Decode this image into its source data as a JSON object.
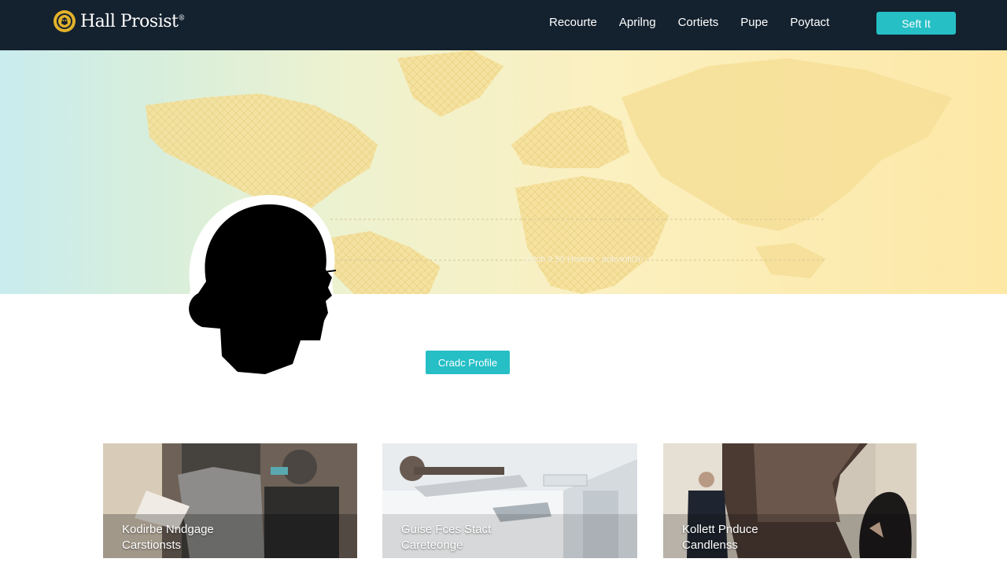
{
  "header": {
    "brand_name": "Hall Prosist",
    "brand_mark": "®",
    "nav": [
      {
        "label": "Recourte"
      },
      {
        "label": "Aprilng"
      },
      {
        "label": "Cortiets"
      },
      {
        "label": "Pupe"
      },
      {
        "label": "Poytact"
      }
    ],
    "cta_label": "Seft It"
  },
  "hero": {
    "caption": "isdob 0 50 Hoieox · aobviotiGn"
  },
  "profile": {
    "button_label": "Cradc Profile"
  },
  "cards": [
    {
      "line1": "Kodirbe Nndgage",
      "line2": "Carstionsts"
    },
    {
      "line1": "Guise Fces Stact",
      "line2": "Careteonge"
    },
    {
      "line1": "Kollett Pnduce",
      "line2": "Candlenss"
    }
  ],
  "colors": {
    "header_bg": "#14212e",
    "accent": "#26bfc6",
    "emblem": "#e2b22b"
  },
  "icons": {
    "brand": "lion-crest-icon",
    "avatar": "person-silhouette-icon"
  }
}
